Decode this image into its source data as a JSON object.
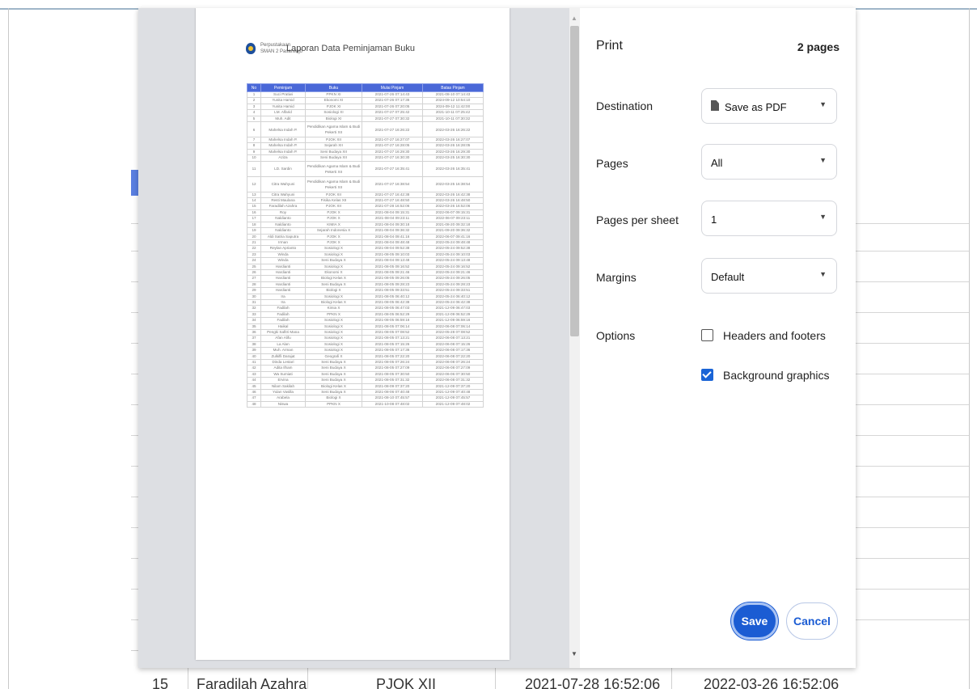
{
  "background": {
    "bottom_row": [
      "15",
      "Faradilah Azahra",
      "PJOK XII",
      "2021-07-28 16:52:06",
      "2022-03-26 16:52:06"
    ]
  },
  "preview": {
    "org_line1": "Perpustakaan",
    "org_line2": "SMAN 2 Pasarwajo",
    "title": "Laporan Data Peminjaman Buku",
    "columns": [
      "No",
      "Peminjam",
      "Buku",
      "Mulai Pinjam",
      "Batas Pinjam"
    ],
    "rows": [
      [
        "1",
        "Suci Pratiwi",
        "PPKN XI",
        "2021-07-26 07:14:43",
        "2021-08-10 07:14:43"
      ],
      [
        "2",
        "Yunita Hamid",
        "Ekonomi XI",
        "2021-07-26 07:17:36",
        "2024-09-12 10:54:10"
      ],
      [
        "3",
        "Yunita Hamid",
        "PJOK XI",
        "2021-07-26 07:20:05",
        "2024-09-12 11:42:00"
      ],
      [
        "4",
        "LM. Alfarid",
        "Sosiologi XI",
        "2021-07-27 07:25:42",
        "2021-10-11 07:25:42"
      ],
      [
        "5",
        "Muh. Adit",
        "Biologi XI",
        "2021-07-27 07:30:32",
        "2021-10-11 07:30:32"
      ],
      [
        "6",
        "Mahelsa Indah P.",
        "Pendidikan Agama Islam & Budi Pekerti XII",
        "2021-07-27 16:26:22",
        "2022-03-26 16:26:22"
      ],
      [
        "7",
        "Mahelsa Indah P.",
        "PJOK XII",
        "2021-07-27 16:27:07",
        "2022-03-26 16:27:07"
      ],
      [
        "8",
        "Mahelsa Indah P.",
        "Sejarah XII",
        "2021-07-27 16:28:05",
        "2022-03-26 16:28:05"
      ],
      [
        "9",
        "Mahelsa Indah P.",
        "Seni Budaya XII",
        "2021-07-27 16:29:30",
        "2022-03-26 16:29:30"
      ],
      [
        "10",
        "Aziza",
        "Seni Budaya XII",
        "2021-07-27 16:30:30",
        "2022-03-25 16:30:30"
      ],
      [
        "11",
        "LD. Sardin",
        "Pendidikan Agama Islam & Budi Pekerti XII",
        "2021-07-27 16:35:41",
        "2022-03-26 16:35:41"
      ],
      [
        "12",
        "Citra Wahyuni",
        "Pendidikan Agama Islam & Budi Pekerti XII",
        "2021-07-27 16:38:54",
        "2022-03-25 16:38:54"
      ],
      [
        "13",
        "Citra Wahyuni",
        "PJOK XII",
        "2021-07-27 16:42:38",
        "2022-03-26 16:42:38"
      ],
      [
        "14",
        "Resti Maulana",
        "Fisika Kelas XII",
        "2021-07-27 16:48:50",
        "2022-03-26 16:48:50"
      ],
      [
        "15",
        "Faradilah Azahra",
        "PJOK XII",
        "2021-07-28 16:52:06",
        "2022-03-26 16:52:06"
      ],
      [
        "16",
        "Roy",
        "PJOK X",
        "2021-08-04 09:15:31",
        "2022-06-07 09:15:31"
      ],
      [
        "17",
        "Naldianto",
        "PJOK X",
        "2021-08-04 09:23:11",
        "2022-06-07 09:23:11"
      ],
      [
        "18",
        "Naldianto",
        "KIMIA X",
        "2021-08-04 09:30:18",
        "2021-08-20 09:32:18"
      ],
      [
        "19",
        "Naldianto",
        "Sejarah Indonesia X",
        "2021-08-04 09:36:32",
        "2021-09-20 09:36:32"
      ],
      [
        "20",
        "Aldi Satria Saputra",
        "PJOK X",
        "2021-08-04 09:41:16",
        "2022-06-07 09:41:16"
      ],
      [
        "21",
        "Irman",
        "PJOK X",
        "2021-08-04 09:48:48",
        "2022-05-24 09:48:48"
      ],
      [
        "22",
        "Reylan Aprianto",
        "Sosiologi X",
        "2021-08-04 09:52:38",
        "2022-05-24 09:52:38"
      ],
      [
        "23",
        "Winda",
        "Sosiologi X",
        "2021-08-05 09:10:03",
        "2022-05-24 09:10:03"
      ],
      [
        "24",
        "Winda",
        "Seni Budaya X",
        "2021-08-04 09:13:48",
        "2022-05-24 09:13:48"
      ],
      [
        "25",
        "Hardianti",
        "Sosiologi X",
        "2021-08-05 09:16:52",
        "2022-05-24 09:16:52"
      ],
      [
        "26",
        "Hardianti",
        "Ekonomi X",
        "2021-08-05 09:21:46",
        "2022-05-24 09:21:46"
      ],
      [
        "27",
        "Hardianti",
        "Biologi Kelas X",
        "2021-08-05 09:26:05",
        "2022-05-24 09:26:05"
      ],
      [
        "28",
        "Hardianti",
        "Seni Budaya X",
        "2021-08-05 09:28:23",
        "2022-05-24 09:28:23"
      ],
      [
        "29",
        "Hardianti",
        "Biologi X",
        "2021-08-05 09:33:51",
        "2022-05-24 09:33:51"
      ],
      [
        "30",
        "Ira",
        "Sosiologi X",
        "2021-08-05 06:40:12",
        "2022-05-24 06:40:12"
      ],
      [
        "31",
        "Ira",
        "Biologi Kelas X",
        "2021-08-05 06:42:38",
        "2022-05-24 06:42:38"
      ],
      [
        "32",
        "Fadilah",
        "Kimia X",
        "2021-08-05 06:47:03",
        "2021-12-09 06:47:03"
      ],
      [
        "33",
        "Fadilah",
        "PPKN X",
        "2021-08-05 06:52:29",
        "2021-12-09 06:52:29"
      ],
      [
        "34",
        "Fadilah",
        "Sosiologi X",
        "2021-08-05 06:59:16",
        "2021-12-09 06:59:16"
      ],
      [
        "35",
        "Haikal",
        "Sosiologi X",
        "2021-08-05 07:06:14",
        "2022-06-08 07:06:14"
      ],
      [
        "36",
        "Pengki Safitri Mana",
        "Sosiologi X",
        "2021-08-05 07:08:52",
        "2022-05-28 07:08:52"
      ],
      [
        "37",
        "Afan Alifu",
        "Sosiologi X",
        "2021-08-05 07:13:21",
        "2022-06-08 07:13:21"
      ],
      [
        "38",
        "La Alan",
        "Sosiologi X",
        "2021-08-05 07:15:26",
        "2022-06-08 07:15:26"
      ],
      [
        "39",
        "Muh. Arman",
        "Sosiologi X",
        "2021-08-05 07:17:36",
        "2022-06-08 07:17:36"
      ],
      [
        "40",
        "Zulkifli Darajat",
        "Geografi X",
        "2021-08-05 07:22:20",
        "2022-06-08 07:22:20"
      ],
      [
        "41",
        "Dinda Lestari",
        "Seni Budaya X",
        "2021-08-05 07:26:24",
        "2022-06-08 07:26:24"
      ],
      [
        "42",
        "Adita Ilham",
        "Seni Budaya X",
        "2021-08-05 07:27:09",
        "2022-06-08 07:27:09"
      ],
      [
        "43",
        "Wa Sumiati",
        "Seni Budaya X",
        "2021-08-05 07:30:50",
        "2022-06-06 07:30:50"
      ],
      [
        "44",
        "Ervina",
        "Seni Budaya X",
        "2021-08-05 07:31:32",
        "2022-06-08 07:31:32"
      ],
      [
        "45",
        "Nilam Sakilah",
        "Biologi Kelas X",
        "2021-08-09 07:37:20",
        "2021-12-09 07:37:20"
      ],
      [
        "46",
        "Yulan Vasilla",
        "Seni Budaya X",
        "2021-08-06 07:40:48",
        "2021-12-09 07:40:48"
      ],
      [
        "47",
        "Arabela",
        "Biologi X",
        "2021-08-10 07:45:57",
        "2021-12-09 07:45:57"
      ],
      [
        "48",
        "Niswa",
        "PPKN X",
        "2021-10-08 07:48:02",
        "2021-12-09 07:48:02"
      ]
    ]
  },
  "print": {
    "title": "Print",
    "page_count": "2 pages",
    "destination": {
      "label": "Destination",
      "value": "Save as PDF",
      "icon": "file-icon"
    },
    "pages": {
      "label": "Pages",
      "value": "All"
    },
    "pages_per_sheet": {
      "label": "Pages per sheet",
      "value": "1"
    },
    "margins": {
      "label": "Margins",
      "value": "Default"
    },
    "options": {
      "label": "Options",
      "headers_footers": {
        "label": "Headers and footers",
        "checked": false
      },
      "background_graphics": {
        "label": "Background graphics",
        "checked": true
      }
    },
    "save_label": "Save",
    "cancel_label": "Cancel",
    "accent_color": "#1b5cd3"
  }
}
